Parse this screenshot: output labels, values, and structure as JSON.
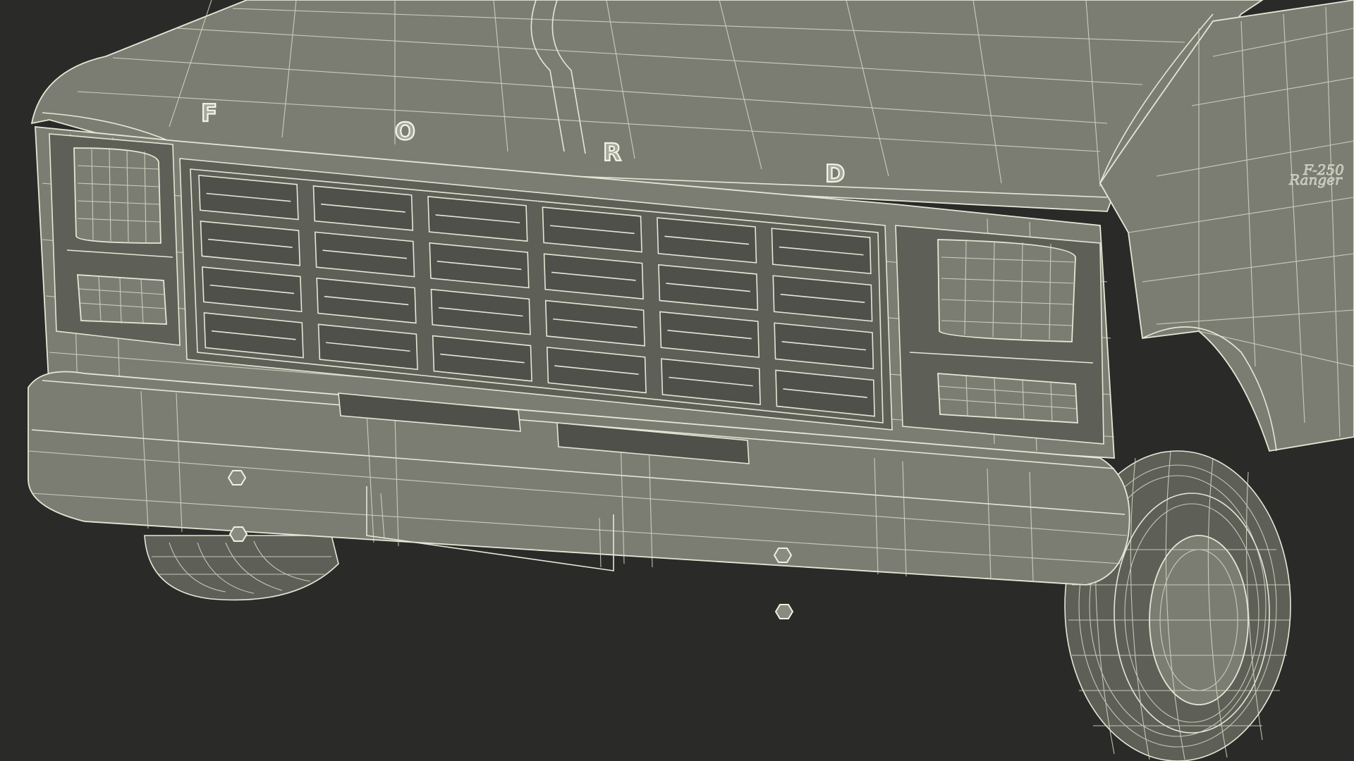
{
  "scene": {
    "background_color": "#2a2a29",
    "body_color": "#7c7d72",
    "wire_color": "#e6e6d6"
  },
  "hood_badge": {
    "letters": [
      "F",
      "O",
      "R",
      "D"
    ]
  },
  "fender_badge": {
    "line1": "Ranger",
    "line2": "F-250"
  }
}
